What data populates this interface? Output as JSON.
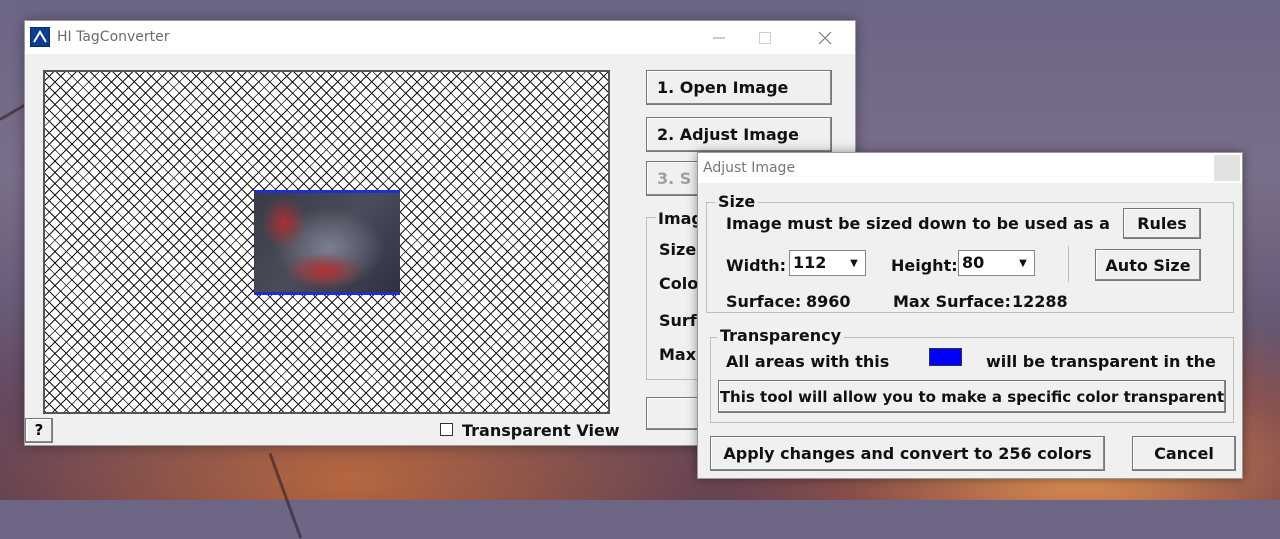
{
  "main_window": {
    "title": "HI TagConverter",
    "minimize_icon": "minimize-icon",
    "maximize_icon": "maximize-icon",
    "close_icon": "close-icon",
    "open_image_label": "1.  Open Image",
    "adjust_image_label": "2.  Adjust Image",
    "step3_label": "3.  S",
    "info_group_label": "Imag",
    "info_labels": [
      "Size",
      "Colo",
      "Surf",
      "Max"
    ],
    "help_label": "?",
    "transparent_view_label": "Transparent View",
    "transparent_view_checked": false
  },
  "adjust_dialog": {
    "title": "Adjust Image",
    "size_group": {
      "legend": "Size",
      "message": "Image must be sized down to be used as a",
      "rules_label": "Rules",
      "width_label": "Width:",
      "width_value": "112",
      "height_label": "Height:",
      "height_value": "80",
      "auto_size_label": "Auto Size",
      "surface_label": "Surface:",
      "surface_value": "8960",
      "max_surface_label": "Max Surface:",
      "max_surface_value": "12288"
    },
    "transparency_group": {
      "legend": "Transparency",
      "message_before": "All areas with this",
      "message_after": "will be transparent in the",
      "swatch_color": "#0000ff",
      "tool_button_label": "This tool will allow you to make a specific color transparent"
    },
    "apply_label": "Apply changes and convert to 256 colors",
    "cancel_label": "Cancel"
  },
  "colors": {
    "preview_border": "#1c2fd0",
    "app_icon": "#0b3d91"
  }
}
